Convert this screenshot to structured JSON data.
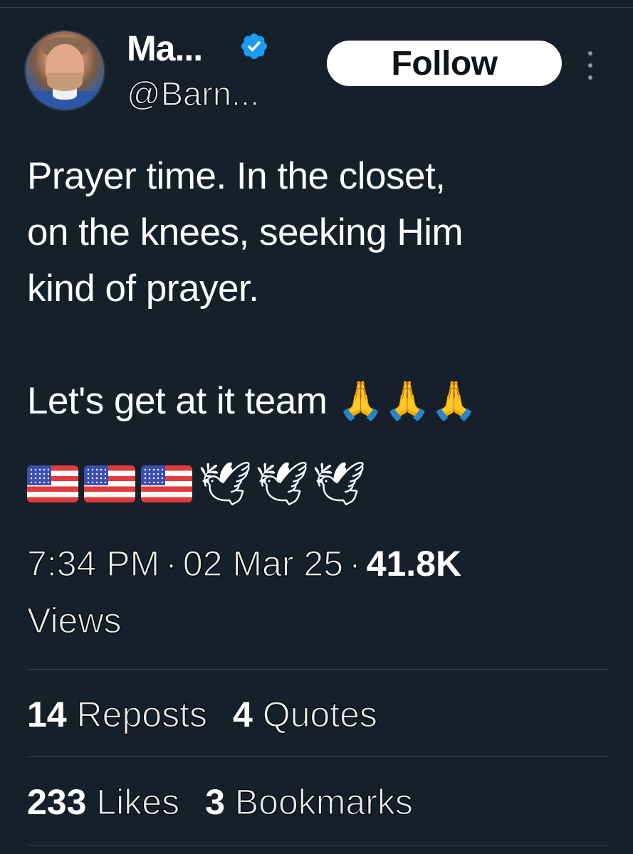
{
  "author": {
    "display_name": "Ma...",
    "handle": "@Barn...",
    "verified": true
  },
  "actions": {
    "follow_label": "Follow",
    "more_icon": "more-vertical-icon"
  },
  "tweet": {
    "lines": [
      "Prayer time. In the closet,",
      "on the knees, seeking Him",
      "kind of prayer.",
      "",
      "Let's get at it team 🙏🙏🙏"
    ],
    "emoji_line": "🇺🇸🇺🇸🇺🇸🕊️🕊️🕊️"
  },
  "meta": {
    "time": "7:34 PM",
    "date": "02 Mar 25",
    "views_count": "41.8K",
    "views_label": "Views"
  },
  "stats": {
    "reposts_count": "14",
    "reposts_label": "Reposts",
    "quotes_count": "4",
    "quotes_label": "Quotes",
    "likes_count": "233",
    "likes_label": "Likes",
    "bookmarks_count": "3",
    "bookmarks_label": "Bookmarks"
  },
  "colors": {
    "background": "#15202b",
    "verified_badge": "#1d9bf0",
    "divider": "#38444d"
  }
}
